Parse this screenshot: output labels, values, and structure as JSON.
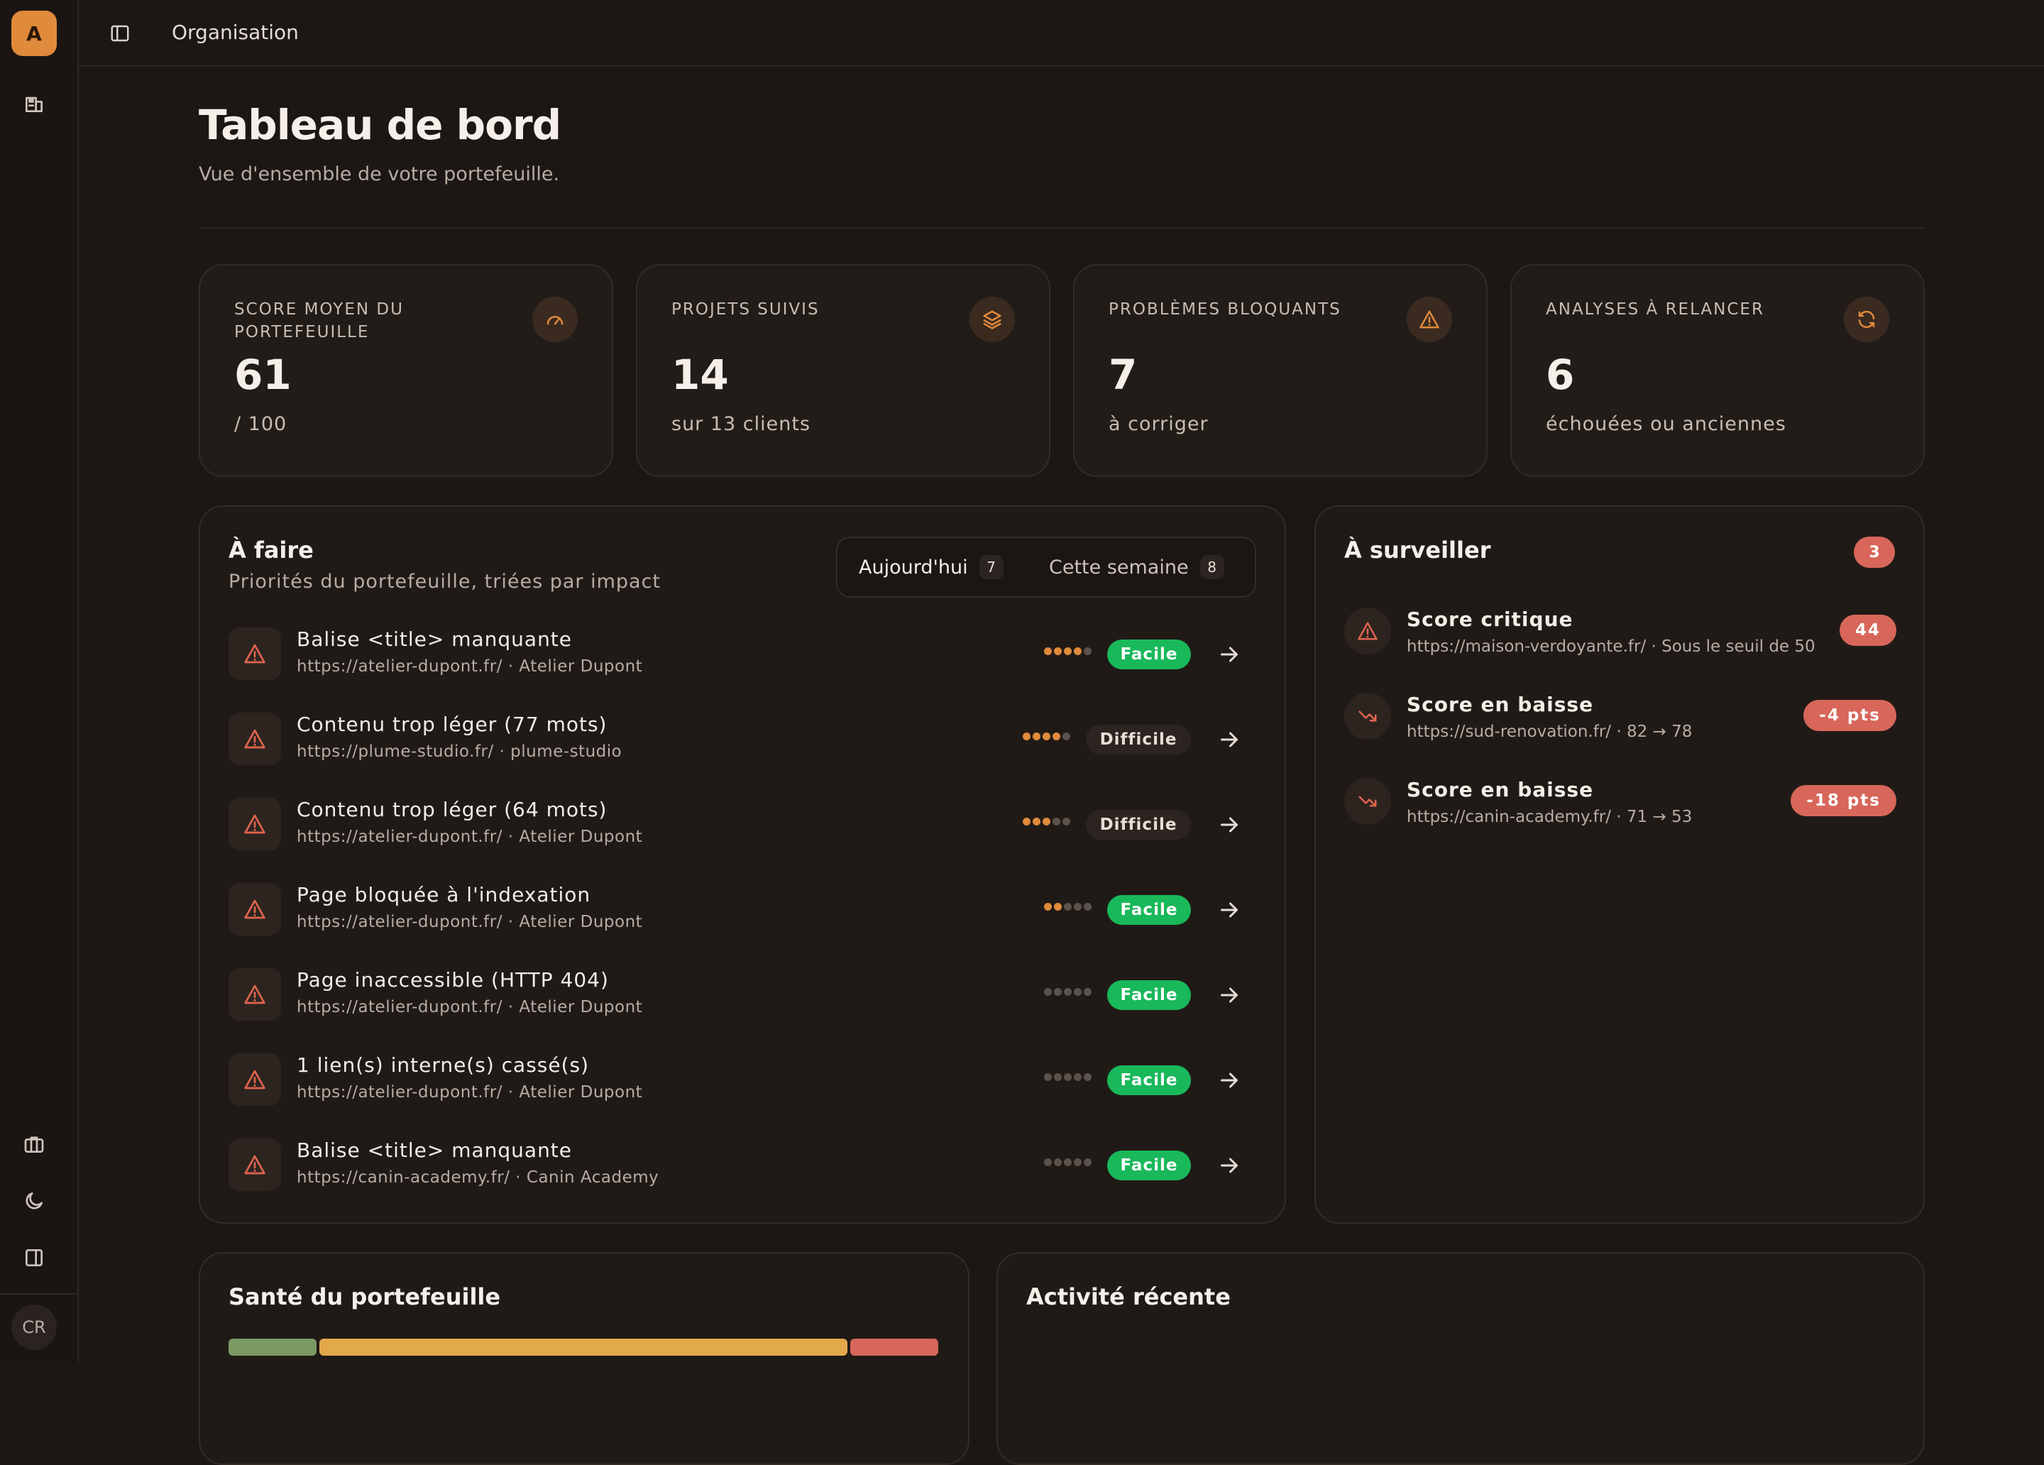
{
  "app": {
    "logo_letter": "A",
    "user_initials": "CR"
  },
  "topbar": {
    "breadcrumb": "Organisation"
  },
  "page": {
    "title": "Tableau de bord",
    "subtitle": "Vue d'ensemble de votre portefeuille."
  },
  "stats": [
    {
      "label": "Score moyen du portefeuille",
      "value": "61",
      "sub": "/ 100",
      "icon": "gauge-icon"
    },
    {
      "label": "Projets suivis",
      "value": "14",
      "sub": "sur 13 clients",
      "icon": "layers-icon"
    },
    {
      "label": "Problèmes bloquants",
      "value": "7",
      "sub": "à corriger",
      "icon": "warning-icon"
    },
    {
      "label": "Analyses à relancer",
      "value": "6",
      "sub": "échouées ou anciennes",
      "icon": "refresh-icon"
    }
  ],
  "todo": {
    "title": "À faire",
    "subtitle": "Priorités du portefeuille, triées par impact",
    "tabs": [
      {
        "label": "Aujourd'hui",
        "count": "7",
        "active": true
      },
      {
        "label": "Cette semaine",
        "count": "8",
        "active": false
      }
    ],
    "items": [
      {
        "title": "Balise <title> manquante",
        "url": "https://atelier-dupont.fr/ · Atelier Dupont",
        "impact": 4,
        "difficulty": "Facile"
      },
      {
        "title": "Contenu trop léger (77 mots)",
        "url": "https://plume-studio.fr/ · plume-studio",
        "impact": 4,
        "difficulty": "Difficile"
      },
      {
        "title": "Contenu trop léger (64 mots)",
        "url": "https://atelier-dupont.fr/ · Atelier Dupont",
        "impact": 3,
        "difficulty": "Difficile"
      },
      {
        "title": "Page bloquée à l'indexation",
        "url": "https://atelier-dupont.fr/ · Atelier Dupont",
        "impact": 2,
        "difficulty": "Facile"
      },
      {
        "title": "Page inaccessible (HTTP 404)",
        "url": "https://atelier-dupont.fr/ · Atelier Dupont",
        "impact": 0,
        "difficulty": "Facile"
      },
      {
        "title": "1 lien(s) interne(s) cassé(s)",
        "url": "https://atelier-dupont.fr/ · Atelier Dupont",
        "impact": 0,
        "difficulty": "Facile"
      },
      {
        "title": "Balise <title> manquante",
        "url": "https://canin-academy.fr/ · Canin Academy",
        "impact": 0,
        "difficulty": "Facile"
      }
    ]
  },
  "watch": {
    "title": "À surveiller",
    "count": "3",
    "items": [
      {
        "title": "Score critique",
        "detail": "https://maison-verdoyante.fr/ · Sous le seuil de 50",
        "badge": "44",
        "icon": "warning-icon"
      },
      {
        "title": "Score en baisse",
        "detail": "https://sud-renovation.fr/ · 82 → 78",
        "badge": "-4 pts",
        "icon": "trend-down-icon"
      },
      {
        "title": "Score en baisse",
        "detail": "https://canin-academy.fr/ · 71 → 53",
        "badge": "-18 pts",
        "icon": "trend-down-icon"
      }
    ]
  },
  "health": {
    "title": "Santé du portefeuille",
    "segments": [
      {
        "fraction": 0.125,
        "color": "#7a9a62"
      },
      {
        "fraction": 0.75,
        "color": "#e2a94a"
      },
      {
        "fraction": 0.125,
        "color": "#d8665a"
      }
    ]
  },
  "activity": {
    "title": "Activité récente"
  },
  "colors": {
    "accent": "#e08a3c",
    "danger": "#d8665a",
    "success": "#19b85a"
  }
}
